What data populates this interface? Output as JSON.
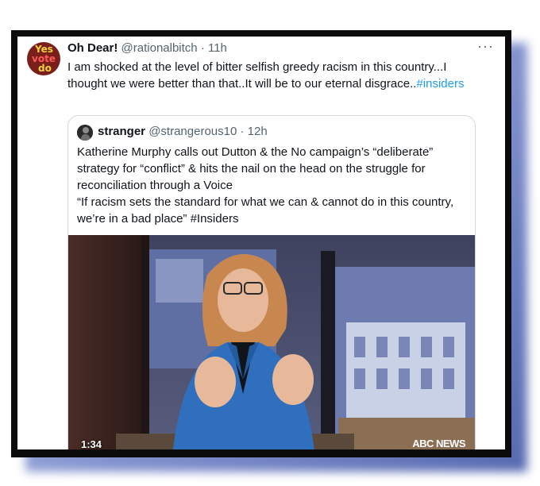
{
  "tweet": {
    "display_name": "Oh Dear!",
    "handle": "@rationalbitch",
    "separator": "·",
    "time": "11h",
    "more_icon": "···",
    "text": "I am shocked at the level of bitter selfish greedy racism in this country...I thought we were better than that..It will be to our eternal disgrace..",
    "hashtag": "#insiders",
    "avatar_text": [
      "Yes",
      "vote",
      "do"
    ]
  },
  "quoted": {
    "display_name": "stranger",
    "handle": "@strangerous10",
    "separator": "·",
    "time": "12h",
    "text_line1": "Katherine Murphy calls out Dutton & the No campaign’s “deliberate” strategy for “conflict” & hits the nail on the head on the struggle for reconciliation through a Voice",
    "text_line2": "“If racism sets the standard for what we can & cannot do in this country, we’re in a bad place” #Insiders",
    "video": {
      "duration": "1:34",
      "network_logo": "ABC NEWS",
      "progress_fraction": 1.0
    }
  },
  "colors": {
    "link": "#1d9bf0",
    "text": "#0f1419",
    "muted": "#536471",
    "border": "#cfd9de",
    "progress": "#e0245e"
  }
}
